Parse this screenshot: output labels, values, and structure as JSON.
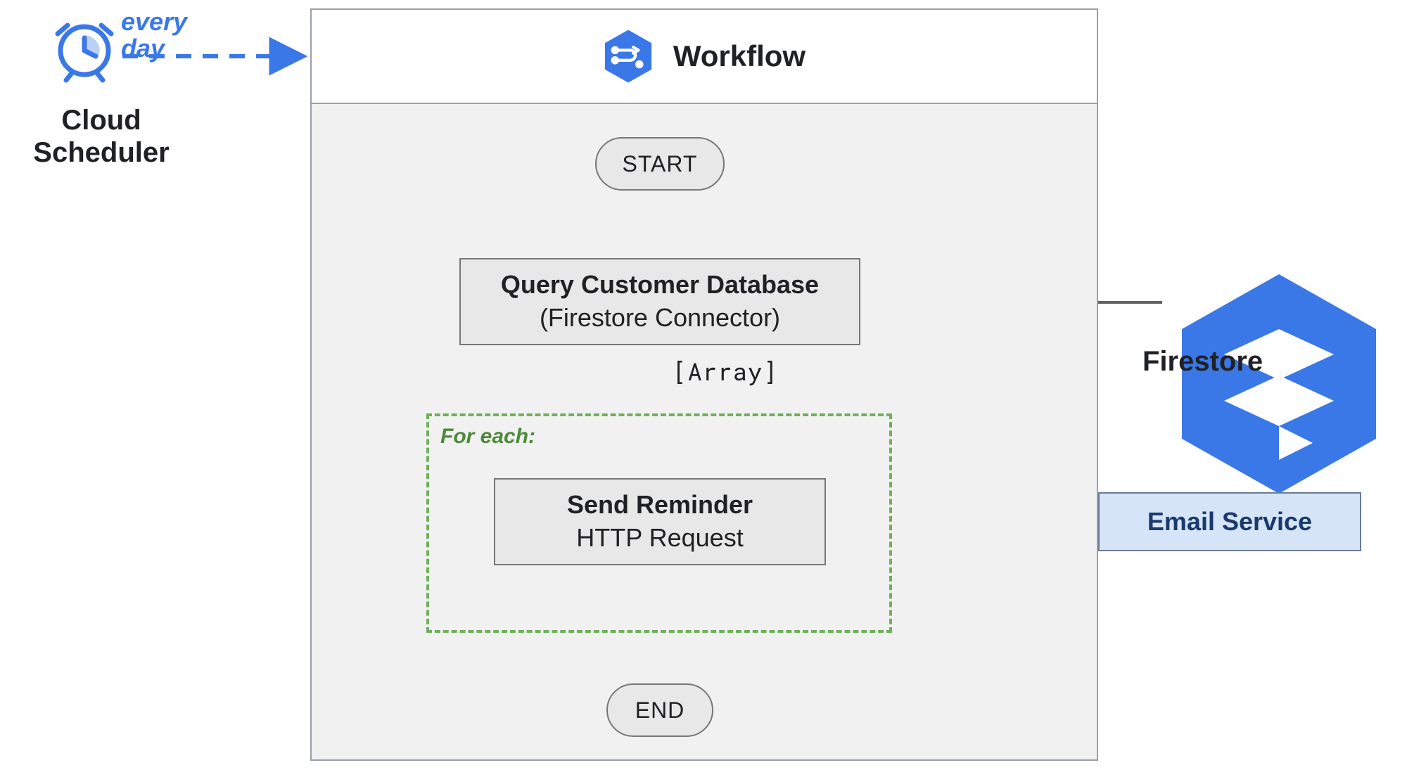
{
  "scheduler": {
    "label": "Cloud\nScheduler",
    "trigger_label": "every\nday"
  },
  "workflow": {
    "title": "Workflow",
    "start_label": "START",
    "end_label": "END",
    "query_step": {
      "title": "Query Customer Database",
      "subtitle": "(Firestore Connector)"
    },
    "array_label": "[Array]",
    "foreach_label": "For each:",
    "send_step": {
      "title": "Send Reminder",
      "subtitle": "HTTP Request"
    }
  },
  "firestore": {
    "label": "Firestore"
  },
  "email_service": {
    "label": "Email Service"
  },
  "colors": {
    "blue": "#3b78e7",
    "green": "#6fb05a",
    "grey_border": "#777777",
    "grey_fill": "#e8e8e8",
    "panel_bg": "#f1f1f1",
    "email_fill": "#d6e4f7",
    "email_border": "#6a7b93"
  }
}
